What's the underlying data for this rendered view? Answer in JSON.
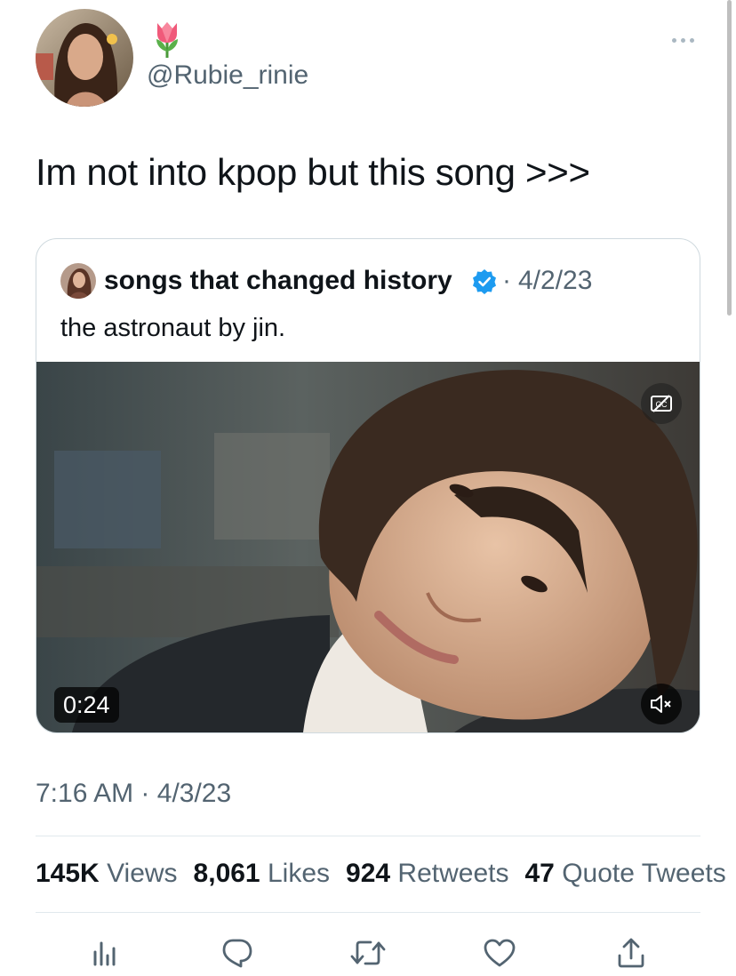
{
  "author": {
    "emoji": "🌷",
    "handle": "@Rubie_rinie"
  },
  "tweet": {
    "text": "Im not into kpop but this song >>>",
    "time": "7:16 AM",
    "separator": "·",
    "date": "4/3/23"
  },
  "quoted": {
    "display_name": "songs that changed history",
    "separator": "·",
    "date": "4/2/23",
    "text": "the astronaut by jin.",
    "video": {
      "duration": "0:24"
    }
  },
  "stats": [
    {
      "count": "145K",
      "label": "Views"
    },
    {
      "count": "8,061",
      "label": "Likes"
    },
    {
      "count": "924",
      "label": "Retweets"
    },
    {
      "count": "47",
      "label": "Quote Tweets"
    }
  ],
  "icons": {
    "more": "more-dots-icon",
    "verified": "verified-badge-icon",
    "captions": "closed-captions-icon",
    "mute": "speaker-muted-icon",
    "analytics": "analytics-icon",
    "reply": "reply-icon",
    "retweet": "retweet-icon",
    "like": "heart-icon",
    "share": "share-icon"
  },
  "colors": {
    "verified": "#1d9bf0",
    "secondary_text": "#536471",
    "icon": "#536471"
  }
}
